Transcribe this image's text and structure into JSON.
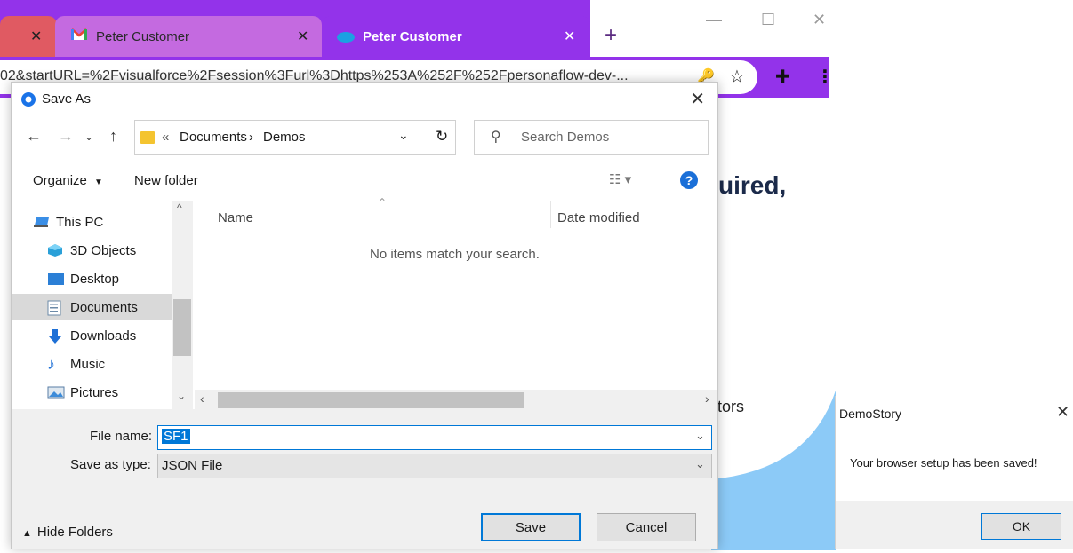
{
  "browser": {
    "tabs": [
      {
        "label": "",
        "close": "✕"
      },
      {
        "label": "Peter Customer",
        "close": "✕"
      },
      {
        "label": "Peter Customer",
        "close": "✕"
      }
    ],
    "new_tab": "+",
    "url": "02&startURL=%2Fvisualforce%2Fsession%3Furl%3Dhttps%253A%252F%252Fpersonaflow-dev-..."
  },
  "page": {
    "heading_fragment": "uired,",
    "tors_fragment": "tors"
  },
  "dialog": {
    "title": "Save As",
    "breadcrumb": {
      "overflow": "«",
      "items": [
        "Documents",
        "Demos"
      ]
    },
    "search_placeholder": "Search Demos",
    "organize_label": "Organize",
    "new_folder_label": "New folder",
    "nav_items": [
      "This PC",
      "3D Objects",
      "Desktop",
      "Documents",
      "Downloads",
      "Music",
      "Pictures"
    ],
    "selected_nav": "Documents",
    "columns": {
      "name": "Name",
      "date": "Date modified"
    },
    "empty_message": "No items match your search.",
    "file_name_label": "File name:",
    "file_name_value": "SF1",
    "save_type_label": "Save as type:",
    "save_type_value": "JSON File",
    "hide_folders_label": "Hide Folders",
    "save_label": "Save",
    "cancel_label": "Cancel"
  },
  "message_box": {
    "title": "DemoStory",
    "message": "Your browser setup has been saved!",
    "ok_label": "OK"
  },
  "colors": {
    "brand_purple": "#9333ea",
    "file_name_selection": "#0078d7",
    "page_light_blue": "#8ccaf7"
  }
}
